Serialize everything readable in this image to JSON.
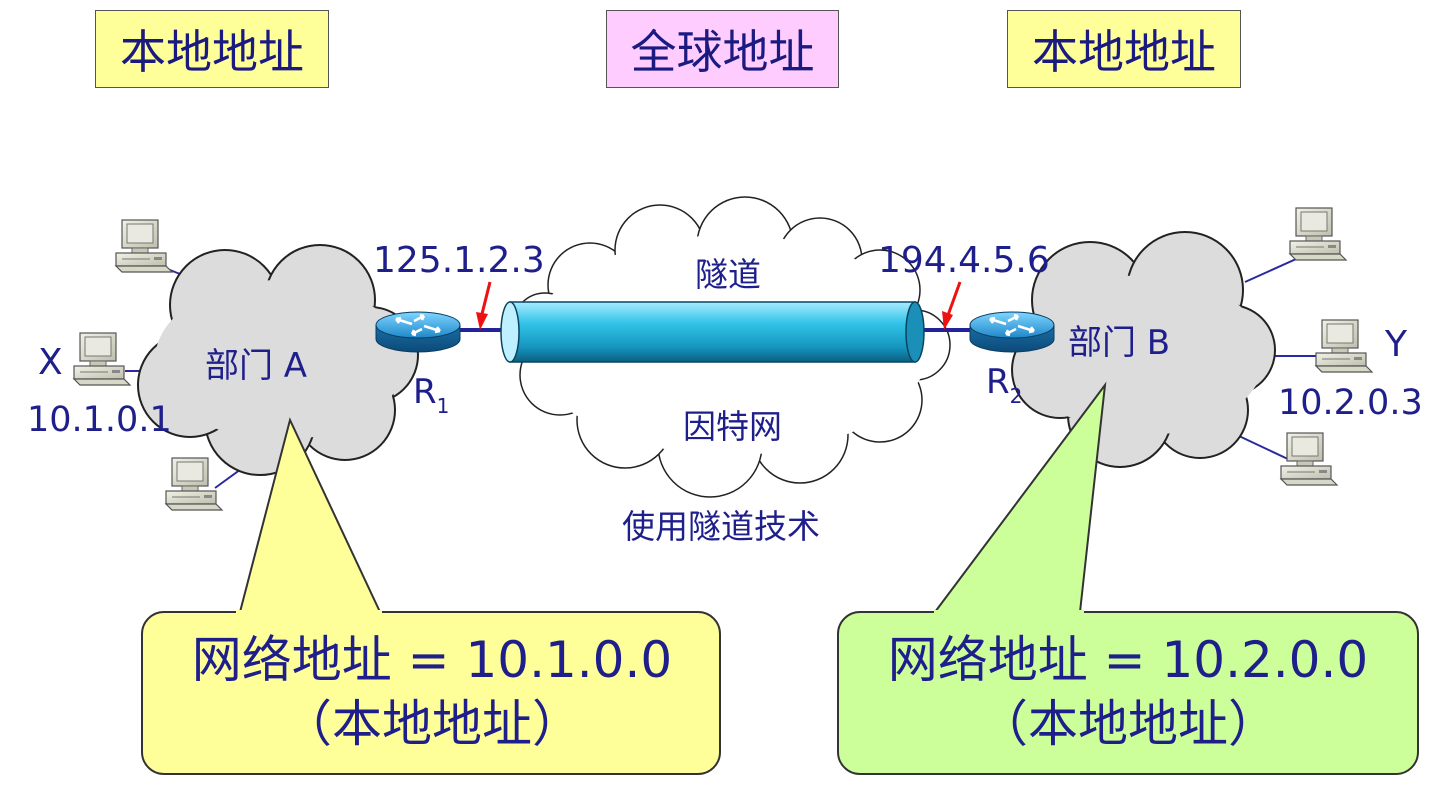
{
  "header": {
    "left_label": "本地地址",
    "center_label": "全球地址",
    "right_label": "本地地址"
  },
  "dept_a": {
    "cloud_label": "部门 A",
    "host_name": "X",
    "host_ip": "10.1.0.1",
    "router_name": "R",
    "router_sub": "1",
    "router_ip": "125.1.2.3"
  },
  "dept_b": {
    "cloud_label": "部门 B",
    "host_name": "Y",
    "host_ip": "10.2.0.3",
    "router_name": "R",
    "router_sub": "2",
    "router_ip": "194.4.5.6"
  },
  "internet": {
    "tunnel_label": "隧道",
    "cloud_label": "因特网",
    "caption": "使用隧道技术"
  },
  "callouts": {
    "a_line1": "网络地址 = 10.1.0.0",
    "a_line2": "（本地地址）",
    "b_line1": "网络地址 = 10.2.0.0",
    "b_line2": "（本地地址）"
  },
  "colors": {
    "local_label_bg": "#ffff99",
    "global_label_bg": "#ffccff",
    "callout_a_bg": "#ffff99",
    "callout_b_bg": "#ccff99",
    "text": "#1f1f8c",
    "cloud_fill": "#dcdcdc",
    "tunnel": "#33bbdd",
    "arrow": "#ee1111"
  }
}
